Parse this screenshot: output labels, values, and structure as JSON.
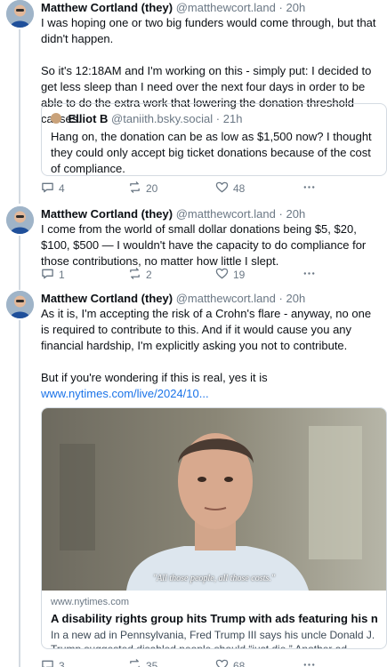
{
  "posts": [
    {
      "author": "Matthew Cortland (they)",
      "handle": "@matthewcort.land",
      "sep": "·",
      "time": "20h",
      "paragraphs": [
        "I was hoping one or two big funders would come through, but that didn't happen.",
        "So it's 12:18AM and I'm working on this - simply put: I decided to get less sleep than I need over the next four days in order to be able to do the extra work that lowering the donation threshold causes."
      ],
      "quote": {
        "author": "Elliot B",
        "handle": "@taniith.bsky.social",
        "sep": "·",
        "time": "21h",
        "text": "Hang on, the donation can be as low as $1,500 now? I thought they could only accept big ticket donations because of the cost of compliance."
      },
      "replies": "4",
      "reposts": "20",
      "likes": "48"
    },
    {
      "author": "Matthew Cortland (they)",
      "handle": "@matthewcort.land",
      "sep": "·",
      "time": "20h",
      "paragraphs": [
        "I come from the world of small dollar donations being $5, $20, $100, $500 — I wouldn't have the capacity to do compliance for those contributions, no matter how little I slept."
      ],
      "replies": "1",
      "reposts": "2",
      "likes": "19"
    },
    {
      "author": "Matthew Cortland (they)",
      "handle": "@matthewcort.land",
      "sep": "·",
      "time": "20h",
      "paragraphs": [
        "As it is, I'm accepting the risk of a Crohn's flare - anyway, no one is required to contribute to this. And if it would cause you any financial hardship, I'm explicitly asking you not to contribute.",
        "But if you're wondering if this is real, yes it is"
      ],
      "link": "www.nytimes.com/live/2024/10...",
      "card": {
        "caption": "\"All those people, all those costs.\"",
        "domain": "www.nytimes.com",
        "title": "A disability rights group hits Trump with ads featuring his nephew.",
        "description": "In a new ad in Pennsylvania, Fred Trump III says his uncle Donald J. Trump suggested disabled people should “just die.” Another ad ..."
      },
      "replies": "3",
      "reposts": "35",
      "likes": "68"
    }
  ],
  "icons": {
    "reply": "reply-icon",
    "repost": "repost-icon",
    "like": "heart-icon",
    "more": "more-icon"
  },
  "colors": {
    "link": "#1a73e8",
    "muted": "#6b7885",
    "border": "#d4dbe2"
  }
}
